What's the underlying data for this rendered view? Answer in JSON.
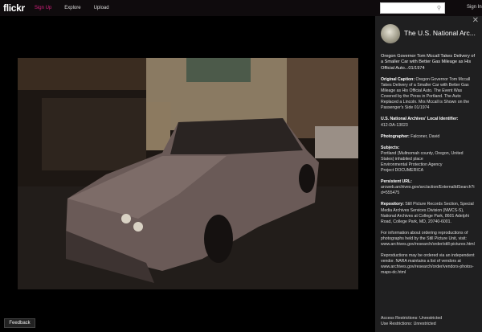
{
  "topbar": {
    "logo": "flickr",
    "signup": "Sign Up",
    "explore": "Explore",
    "upload": "Upload",
    "search_placeholder": "",
    "signin": "Sign In"
  },
  "panel": {
    "owner": "The U.S. National Arc...",
    "title": "Oregon Governor Tom Mccall Takes Delivery of a Smaller Car with Better Gas Mileage as His Official Auto...01/1974",
    "caption_label": "Original Caption:",
    "caption": "Oregon Governor Tom Mccall Takes Delivery of a Smaller Car with Better Gas Mileage as His Official Auto. The Event Was Covered by the Press in Portland. The Auto Replaced a Lincoln. Mrs Mccall is Shown on the Passenger's Side 01/1974",
    "identifier_label": "U.S. National Archives' Local Identifier:",
    "identifier": "412-DA-13023",
    "photographer_label": "Photographer:",
    "photographer": "Falconer, David",
    "subjects_label": "Subjects:",
    "subjects": [
      "Portland (Multnomah county, Oregon, United States) inhabited place",
      "Environmental Protection Agency",
      "Project DOCUMERICA"
    ],
    "url_label": "Persistent URL:",
    "url": "arcweb.archives.gov/arc/action/ExternalIdSearch?id=555475",
    "repository_label": "Repository:",
    "repository": "Still Picture Records Section, Special Media Archives Services Division (NWCS-S), National Archives at College Park, 8601 Adelphi Road, College Park, MD, 20740-6001.",
    "ordering": "For information about ordering reproductions of photographs held by the Still Picture Unit, visit: www.archives.gov/research/order/still-pictures.html",
    "vendors": "Reproductions may be ordered via an independent vendor. NARA maintains a list of vendors at www.archives.gov/research/order/vendors-photos-maps-dc.html",
    "access": "Access Restrictions: Unrestricted",
    "use": "Use Restrictions: Unrestricted"
  },
  "feedback": "Feedback"
}
